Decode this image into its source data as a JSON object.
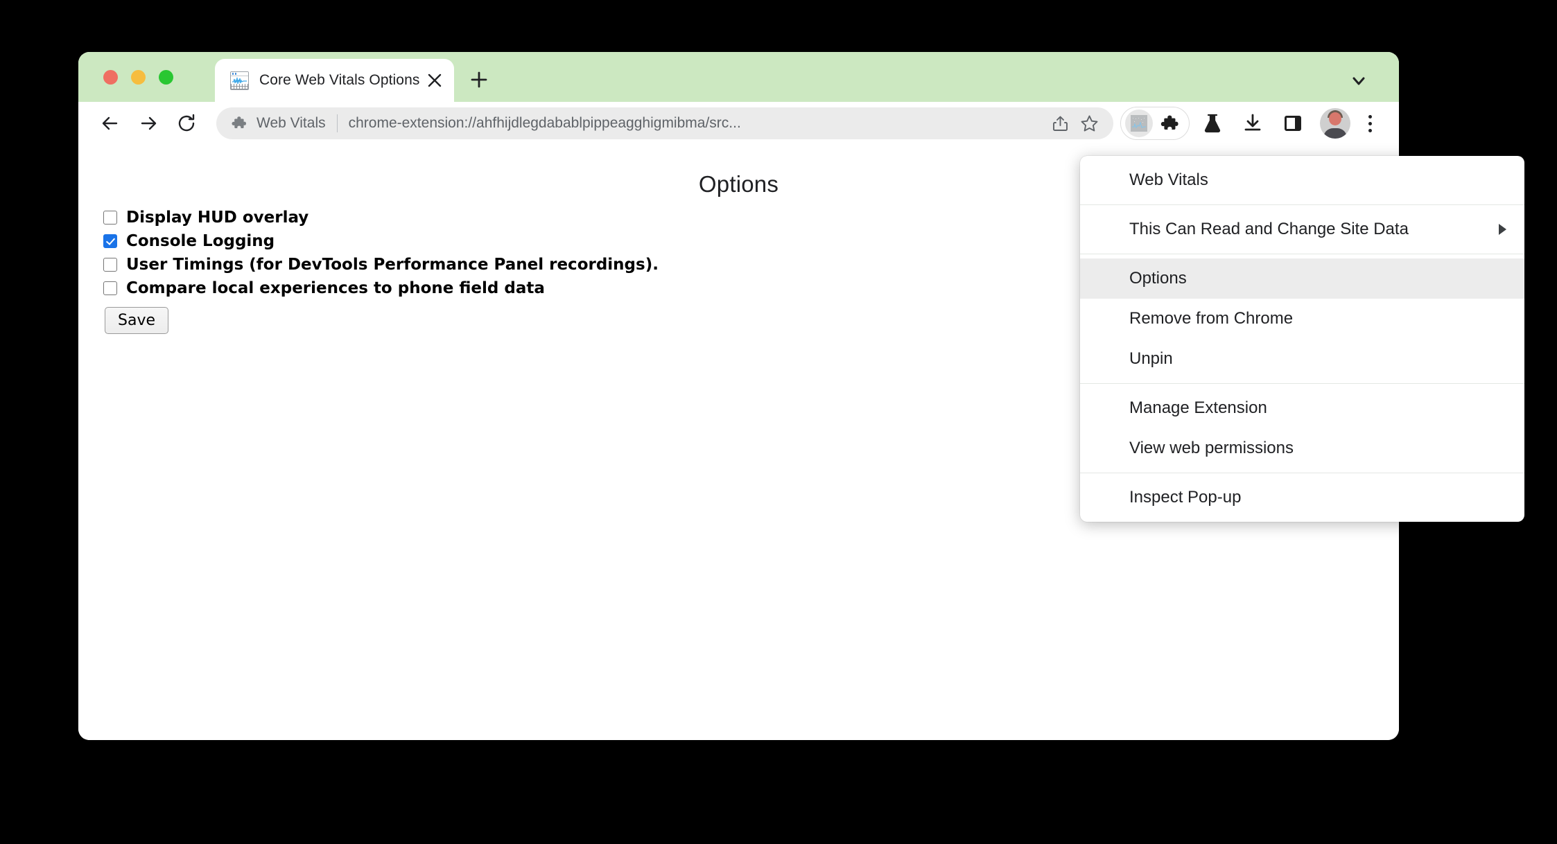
{
  "window": {
    "traffic_lights": [
      "close",
      "minimize",
      "maximize"
    ]
  },
  "tab_strip": {
    "active_tab": {
      "title": "Core Web Vitals Options",
      "favicon": "web-vitals-chart-icon",
      "close_label": "×"
    },
    "new_tab_label": "+",
    "chevron": "chevron-down-icon",
    "background_color": "#cce8c1"
  },
  "toolbar": {
    "back": "back-arrow-icon",
    "forward": "forward-arrow-icon",
    "reload": "reload-icon",
    "omnibox": {
      "extension_icon": "puzzle-piece-icon",
      "extension_name": "Web Vitals",
      "url": "chrome-extension://ahfhijdlegdabablpippeagghigmibma/src...",
      "share_icon": "share-icon",
      "bookmark_icon": "star-icon"
    },
    "pinned_extension": "web-vitals-extension-icon",
    "extensions_icon": "puzzle-piece-icon",
    "lab_icon": "flask-icon",
    "downloads_icon": "download-icon",
    "side_panel_icon": "side-panel-icon",
    "avatar": "profile-avatar",
    "more_menu": "three-dot-menu-icon"
  },
  "page": {
    "title": "Options",
    "options": [
      {
        "label": "Display HUD overlay",
        "checked": false
      },
      {
        "label": "Console Logging",
        "checked": true
      },
      {
        "label": "User Timings (for DevTools Performance Panel recordings).",
        "checked": false
      },
      {
        "label": "Compare local experiences to phone field data",
        "checked": false
      }
    ],
    "save_label": "Save",
    "checked_color": "#1a73e8"
  },
  "context_menu": {
    "groups": [
      {
        "items": [
          {
            "label": "Web Vitals",
            "highlighted": false,
            "submenu": false
          }
        ]
      },
      {
        "items": [
          {
            "label": "This Can Read and Change Site Data",
            "highlighted": false,
            "submenu": true
          }
        ]
      },
      {
        "items": [
          {
            "label": "Options",
            "highlighted": true,
            "submenu": false
          },
          {
            "label": "Remove from Chrome",
            "highlighted": false,
            "submenu": false
          },
          {
            "label": "Unpin",
            "highlighted": false,
            "submenu": false
          }
        ]
      },
      {
        "items": [
          {
            "label": "Manage Extension",
            "highlighted": false,
            "submenu": false
          },
          {
            "label": "View web permissions",
            "highlighted": false,
            "submenu": false
          }
        ]
      },
      {
        "items": [
          {
            "label": "Inspect Pop-up",
            "highlighted": false,
            "submenu": false
          }
        ]
      }
    ]
  }
}
